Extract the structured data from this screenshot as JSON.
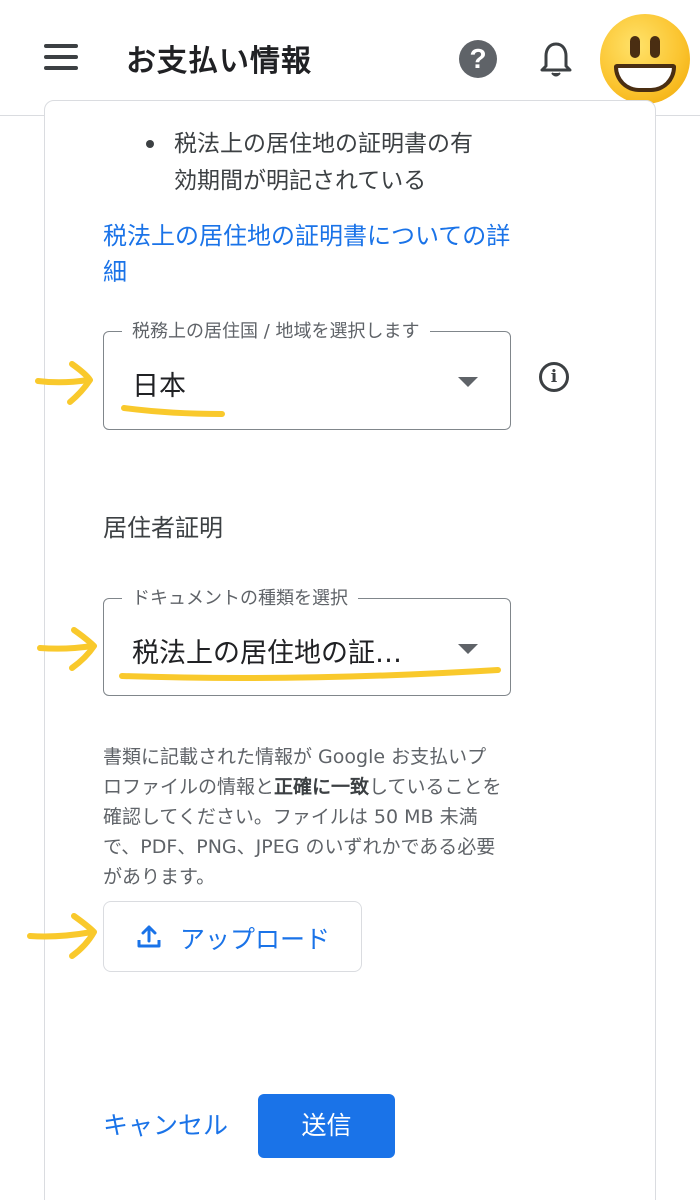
{
  "appbar": {
    "title": "お支払い情報",
    "menu_icon": "hamburger-menu-icon",
    "help_icon": "help-icon",
    "bell_icon": "notifications-icon",
    "avatar": "grinning-face-emoji-avatar"
  },
  "content": {
    "bullet_line1": "税法上の居住地の証明書の有",
    "bullet_line2": "効期間が明記されている",
    "detail_link": "税法上の居住地の証明書についての詳細",
    "country_select": {
      "label": "税務上の居住国 / 地域を選択します",
      "value": "日本"
    },
    "residency_heading": "居住者証明",
    "document_select": {
      "label": "ドキュメントの種類を選択",
      "value": "税法上の居住地の証…"
    },
    "notice": {
      "part1": "書類に記載された情報が Google お支払いプロファイルの情報と",
      "bold": "正確に一致",
      "part2": "していることを確認してください。ファイルは 50 MB 未満で、PDF、PNG、JPEG のいずれかである必要があります。"
    },
    "upload_label": "アップロード",
    "cancel_label": "キャンセル",
    "submit_label": "送信"
  },
  "colors": {
    "link_blue": "#1a73e8",
    "annotation_yellow": "#f9c92c",
    "border_gray": "#80868b"
  }
}
